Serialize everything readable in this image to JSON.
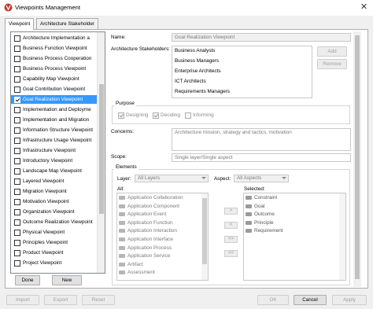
{
  "window": {
    "title": "Viewpoints Management"
  },
  "tabs": [
    {
      "label": "Viewpoint",
      "active": true
    },
    {
      "label": "Architecture Stakeholder",
      "active": false
    }
  ],
  "viewpoints": [
    {
      "label": "Architecture Implementation a",
      "checked": false,
      "selected": false
    },
    {
      "label": "Business Function Viewpoint",
      "checked": false,
      "selected": false
    },
    {
      "label": "Business Process Cooperation",
      "checked": false,
      "selected": false
    },
    {
      "label": "Business Process Viewpoint",
      "checked": false,
      "selected": false
    },
    {
      "label": "Capability Map Viewpoint",
      "checked": false,
      "selected": false
    },
    {
      "label": "Goal Contribution Viewpoint",
      "checked": false,
      "selected": false
    },
    {
      "label": "Goal Realization Viewpoint",
      "checked": true,
      "selected": true
    },
    {
      "label": "Implementation and Deployme",
      "checked": false,
      "selected": false
    },
    {
      "label": "Implementation and Migration",
      "checked": false,
      "selected": false
    },
    {
      "label": "Information Structure Viewpoint",
      "checked": false,
      "selected": false
    },
    {
      "label": "Infrastructure Usage Viewpoint",
      "checked": false,
      "selected": false
    },
    {
      "label": "Infrastructure Viewpoint",
      "checked": false,
      "selected": false
    },
    {
      "label": "Introductory Viewpoint",
      "checked": false,
      "selected": false
    },
    {
      "label": "Landscape Map Viewpoint",
      "checked": false,
      "selected": false
    },
    {
      "label": "Layered Viewpoint",
      "checked": false,
      "selected": false
    },
    {
      "label": "Migration Viewpoint",
      "checked": false,
      "selected": false
    },
    {
      "label": "Motivation Viewpoint",
      "checked": false,
      "selected": false
    },
    {
      "label": "Organization Viewpoint",
      "checked": false,
      "selected": false
    },
    {
      "label": "Outcome Realization Viewpoint",
      "checked": false,
      "selected": false
    },
    {
      "label": "Physical Viewpoint",
      "checked": false,
      "selected": false
    },
    {
      "label": "Principles Viewpoint",
      "checked": false,
      "selected": false
    },
    {
      "label": "Product Viewpoint",
      "checked": false,
      "selected": false
    },
    {
      "label": "Project Viewpoint",
      "checked": false,
      "selected": false
    }
  ],
  "list_buttons": {
    "done": "Done",
    "new": "New"
  },
  "form": {
    "name_label": "Name:",
    "name_value": "Goal Realization Viewpoint",
    "stakeholders_label": "Architecture Stakeholders:",
    "stakeholders": [
      "Business Analysts",
      "Business Managers",
      "Enterprise Architects",
      "ICT Architects",
      "Requirements Managers"
    ],
    "add_label": "Add",
    "remove_label": "Remove",
    "purpose_label": "Purpose",
    "purpose_options": [
      {
        "label": "Designing",
        "checked": true
      },
      {
        "label": "Deciding",
        "checked": true
      },
      {
        "label": "Informing",
        "checked": false
      }
    ],
    "concerns_label": "Concerns:",
    "concerns_value": "Architecture mission, strategy and tactics, motivation",
    "scope_label": "Scope:",
    "scope_value": "Single layer/Single aspect",
    "elements_label": "Elements",
    "layer_label": "Layer:",
    "layer_value": "All Layers",
    "aspect_label": "Aspect:",
    "aspect_value": "All Aspects",
    "all_label": "All:",
    "selected_label": "Selected:",
    "all_elements": [
      "Application Collaboration",
      "Application Component",
      "Application Event",
      "Application Function",
      "Application Interaction",
      "Application Interface",
      "Application Process",
      "Application Service",
      "Artifact",
      "Assessment"
    ],
    "selected_elements": [
      "Constraint",
      "Goal",
      "Outcome",
      "Principle",
      "Requirement"
    ],
    "move_buttons": [
      ">",
      "<",
      ">>",
      "<<"
    ]
  },
  "bottom_buttons": {
    "import": "Import",
    "export": "Export",
    "reset": "Reset",
    "ok": "OK",
    "cancel": "Cancel",
    "apply": "Apply"
  }
}
